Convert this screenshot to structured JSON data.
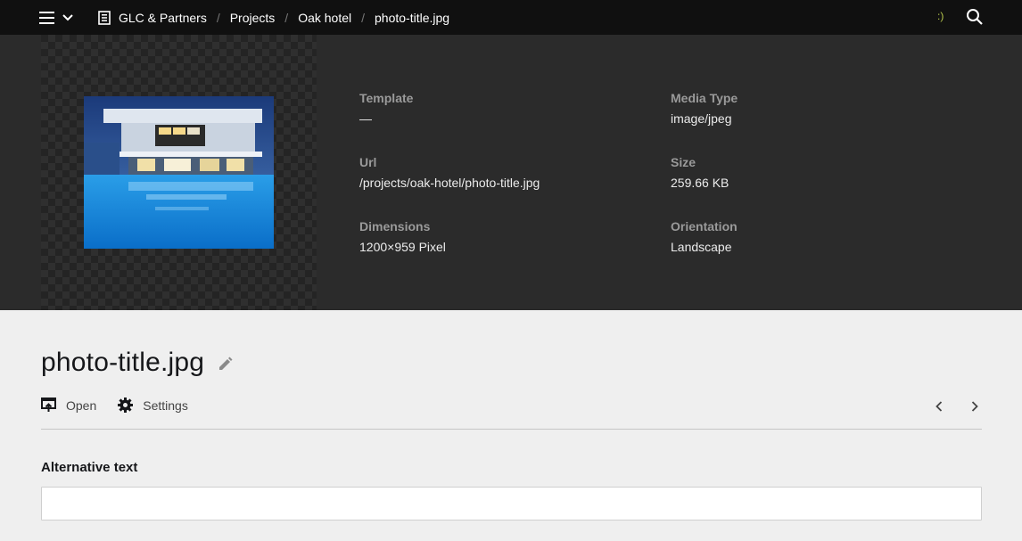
{
  "topbar": {
    "breadcrumbs": [
      "GLC & Partners",
      "Projects",
      "Oak hotel",
      "photo-title.jpg"
    ],
    "separator": "/",
    "smiley": ":)",
    "icons": {
      "menu": "hamburger-icon",
      "dropdown": "chevron-down-icon",
      "site": "page-icon",
      "search": "search-icon"
    }
  },
  "file_info": {
    "template": {
      "label": "Template",
      "value": "—"
    },
    "media_type": {
      "label": "Media Type",
      "value": "image/jpeg"
    },
    "url": {
      "label": "Url",
      "value": "/projects/oak-hotel/photo-title.jpg"
    },
    "size": {
      "label": "Size",
      "value": "259.66 KB"
    },
    "dimensions": {
      "label": "Dimensions",
      "value": "1200×959 Pixel"
    },
    "orientation": {
      "label": "Orientation",
      "value": "Landscape"
    }
  },
  "main": {
    "title": "photo-title.jpg",
    "actions": {
      "open": "Open",
      "settings": "Settings"
    },
    "fields": {
      "alt_label": "Alternative text",
      "alt_value": ""
    }
  },
  "colors": {
    "topbar": "#101010",
    "header_bg": "#2b2b2b",
    "page_bg": "#efefef",
    "accent_smiley": "#b5c64d"
  }
}
